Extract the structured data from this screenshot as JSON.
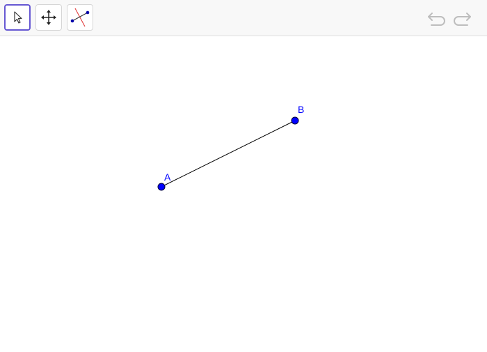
{
  "toolbar": {
    "tools": [
      {
        "name": "select",
        "icon": "cursor-arrow-icon",
        "active": true
      },
      {
        "name": "move",
        "icon": "move-arrows-icon",
        "active": false
      },
      {
        "name": "perpendicular-bisector",
        "icon": "perpendicular-bisector-icon",
        "active": false
      }
    ],
    "undo_icon": "undo-icon",
    "redo_icon": "redo-icon"
  },
  "construction": {
    "point_color": "#0000ff",
    "segment_color": "#000000",
    "points": [
      {
        "label": "A"
      },
      {
        "label": "B"
      }
    ],
    "segments": [
      {
        "from": "A",
        "to": "B"
      }
    ]
  },
  "colors": {
    "active_tool_border": "#6557d2",
    "toolbar_background": "#f8f8f8",
    "bisector_line": "#e03030",
    "disabled_icon": "#bdbdbd"
  }
}
